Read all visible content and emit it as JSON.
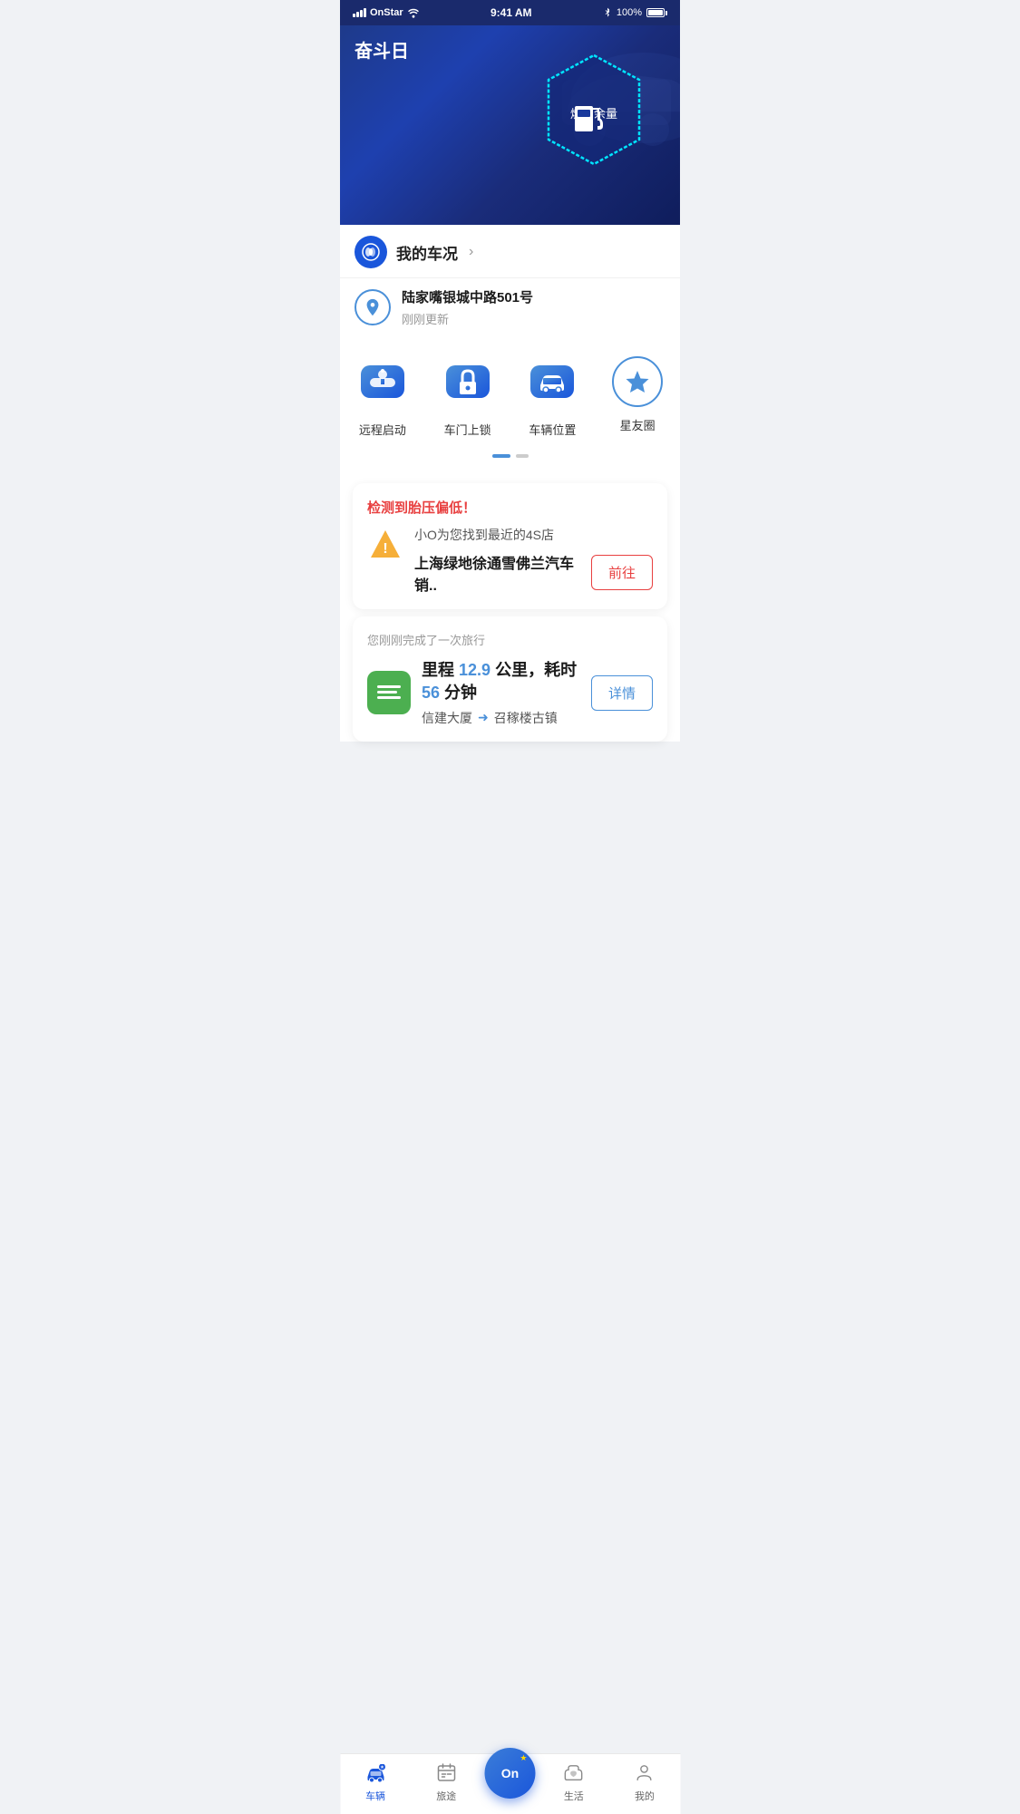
{
  "statusBar": {
    "carrier": "OnStar",
    "time": "9:41 AM",
    "battery": "100%"
  },
  "hero": {
    "title": "奋斗日",
    "fuel": {
      "label": "燃油余量"
    }
  },
  "vehicleStatus": {
    "label": "我的车况",
    "arrow": "›"
  },
  "location": {
    "address": "陆家嘴银城中路501号",
    "updated": "刚刚更新"
  },
  "quickActions": [
    {
      "id": "remote-start",
      "label": "远程启动"
    },
    {
      "id": "door-lock",
      "label": "车门上锁"
    },
    {
      "id": "vehicle-location",
      "label": "车辆位置"
    },
    {
      "id": "star-circle",
      "label": "星友圈"
    }
  ],
  "alertCard": {
    "title": "检测到胎压偏低！",
    "subtitle": "小O为您找到最近的4S店",
    "storeName": "上海绿地徐通雪佛兰汽车销..",
    "buttonLabel": "前往"
  },
  "tripCard": {
    "subtitle": "您刚刚完成了一次旅行",
    "stats": {
      "distanceLabel": "里程",
      "distance": "12.9",
      "distanceUnit": "公里，耗时",
      "duration": "56",
      "durationUnit": "分钟"
    },
    "from": "信建大厦",
    "to": "召稼楼古镇",
    "buttonLabel": "详情"
  },
  "bottomNav": {
    "items": [
      {
        "id": "vehicle",
        "label": "车辆",
        "active": true
      },
      {
        "id": "journey",
        "label": "旅途",
        "active": false
      },
      {
        "id": "center",
        "label": "On",
        "active": false
      },
      {
        "id": "life",
        "label": "生活",
        "active": false
      },
      {
        "id": "mine",
        "label": "我的",
        "active": false
      }
    ]
  }
}
